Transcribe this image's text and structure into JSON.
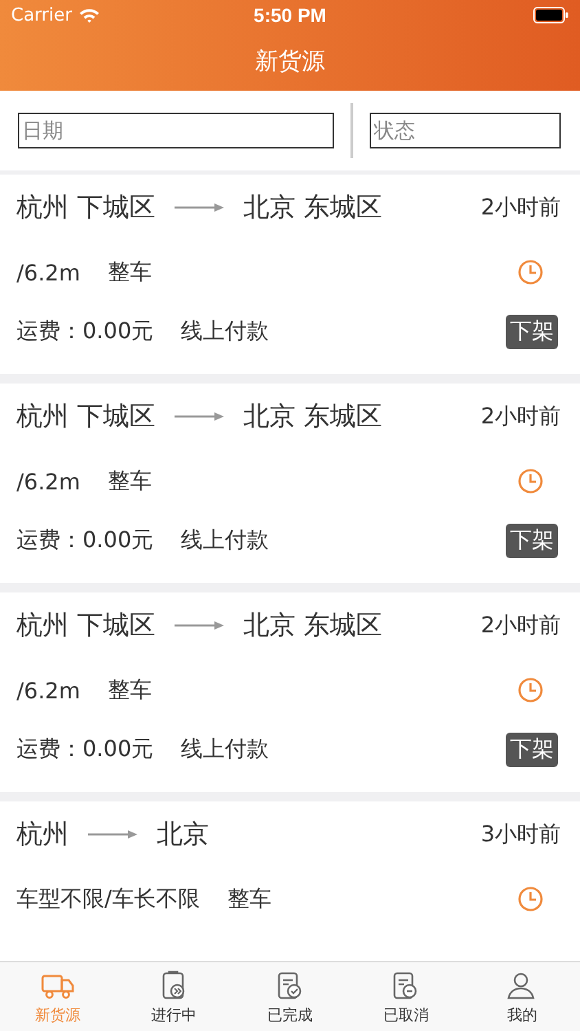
{
  "status_bar": {
    "carrier": "Carrier",
    "time": "5:50 PM"
  },
  "nav": {
    "title": "新货源"
  },
  "filters": [
    {
      "placeholder": "日期"
    },
    {
      "placeholder": "状态"
    }
  ],
  "cargo": [
    {
      "from": "杭州 下城区",
      "to": "北京 东城区",
      "posted": "2小时前",
      "spec": "/6.2m",
      "load": "整车",
      "fee": "运费：0.00元",
      "payment": "线上付款",
      "button": {
        "label": "下架",
        "kind": "unlist"
      }
    },
    {
      "from": "杭州 下城区",
      "to": "北京 东城区",
      "posted": "2小时前",
      "spec": "/6.2m",
      "load": "整车",
      "fee": "运费：0.00元",
      "payment": "线上付款",
      "button": {
        "label": "下架",
        "kind": "unlist"
      }
    },
    {
      "from": "杭州 下城区",
      "to": "北京 东城区",
      "posted": "2小时前",
      "spec": "/6.2m",
      "load": "整车",
      "fee": "运费：0.00元",
      "payment": "线上付款",
      "button": {
        "label": "下架",
        "kind": "unlist"
      }
    },
    {
      "from": "杭州",
      "to": "北京",
      "posted": "3小时前",
      "spec": "车型不限/车长不限",
      "load": "整车"
    }
  ],
  "tab_bar": [
    {
      "label": "新货源",
      "kind": "truck",
      "selected": true
    },
    {
      "label": "进行中",
      "kind": "progress",
      "selected": false
    },
    {
      "label": "已完成",
      "kind": "done",
      "selected": false
    },
    {
      "label": "已取消",
      "kind": "cancel",
      "selected": false
    },
    {
      "label": "我的",
      "kind": "person",
      "selected": false
    }
  ]
}
